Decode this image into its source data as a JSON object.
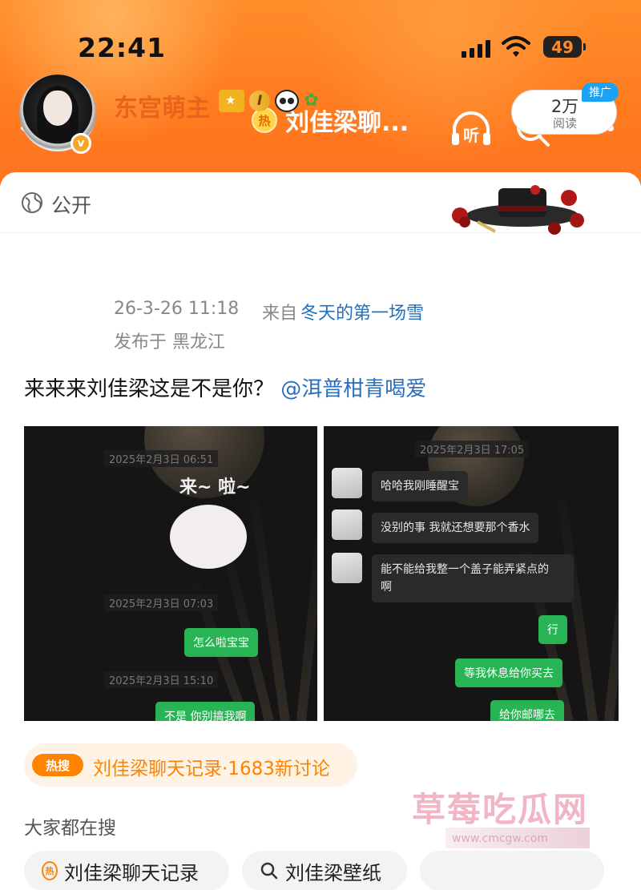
{
  "status_bar": {
    "time": "22:41",
    "battery": "49"
  },
  "nav": {
    "hot_badge": "热",
    "title": "刘佳梁聊...",
    "listen_label": "听"
  },
  "post": {
    "visibility": "公开",
    "author": "东宫萌主",
    "level_badge": "I",
    "time": "26-3-26 11:18",
    "from_prefix": "来自",
    "source": "冬天的第一场雪",
    "location": "发布于  黑龙江",
    "read_count": "2万",
    "read_label": "阅读",
    "promo_label": "推广",
    "text": "来来来刘佳梁这是不是你？",
    "mention": "@洱普柑青喝爱"
  },
  "screenshot_left": {
    "timestamps": [
      "2025年2月3日 06:51",
      "2025年2月3日 07:03",
      "2025年2月3日 15:10"
    ],
    "sticker_text": "来~ 啦~",
    "messages": [
      "怎么啦宝宝",
      "不是 你别搞我啊"
    ]
  },
  "screenshot_right": {
    "timestamp": "2025年2月3日 17:05",
    "incoming": [
      "哈哈我刚睡醒宝",
      "没别的事 我就还想要那个香水",
      "能不能给我整一个盖子能弄紧点的\n啊"
    ],
    "outgoing": [
      "行",
      "等我休息给你买去",
      "给你邮哪去"
    ]
  },
  "hot_tag": {
    "icon": "热搜",
    "text": "刘佳梁聊天记录·1683新讨论"
  },
  "search": {
    "title": "大家都在搜",
    "chips": [
      {
        "hot": "热",
        "label": "刘佳梁聊天记录"
      },
      {
        "label": "刘佳梁壁纸"
      }
    ]
  },
  "watermark": {
    "main": "草莓吃瓜网",
    "sub": "www.cmcgw.com"
  },
  "colors": {
    "header_orange": "#ff7a1f",
    "accent_orange": "#ff8200",
    "link_blue": "#1f6fbf",
    "chat_green": "#28b454"
  }
}
